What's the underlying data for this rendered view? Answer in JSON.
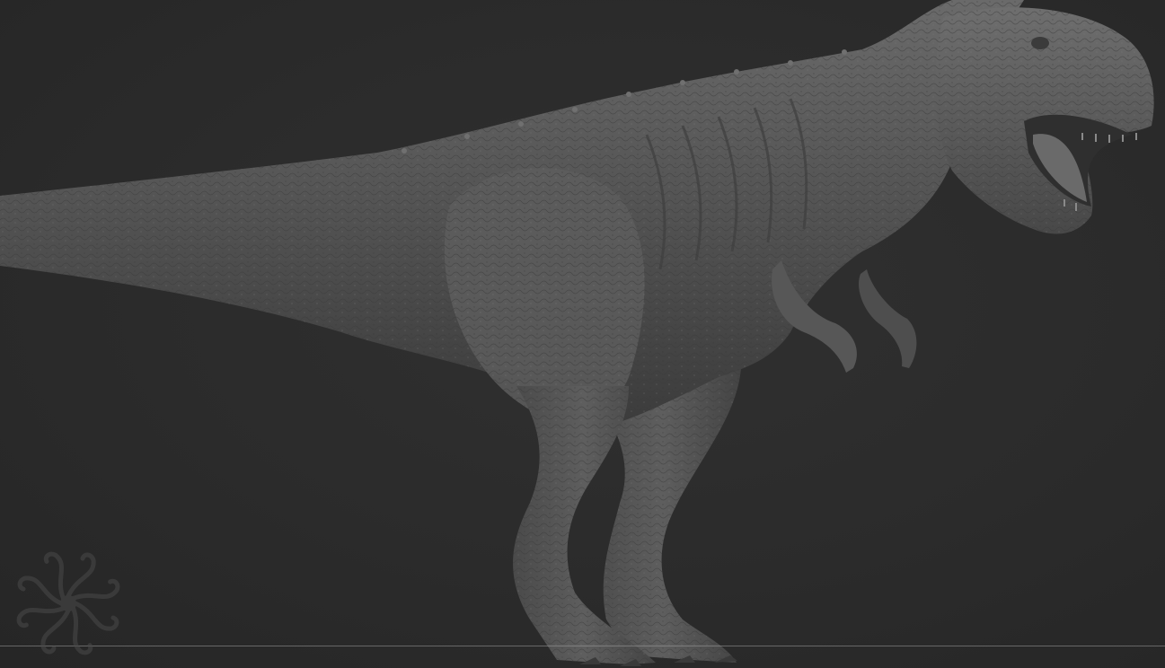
{
  "scene": {
    "subject": "t-rex-sculpt",
    "material_color": "#5a5a5a",
    "background_color": "#2b2b2b",
    "ground_line_color": "#9a9a9a"
  },
  "icons": {
    "logo": "spiral-logo-icon"
  }
}
